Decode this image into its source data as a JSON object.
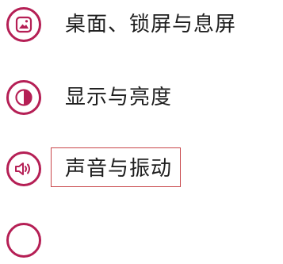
{
  "settings": {
    "items": [
      {
        "label": "桌面、锁屏与息屏",
        "icon": "wallpaper-icon"
      },
      {
        "label": "显示与亮度",
        "icon": "brightness-icon"
      },
      {
        "label": "声音与振动",
        "icon": "speaker-icon",
        "highlighted": true
      },
      {
        "label": "",
        "icon": "partial-icon"
      }
    ]
  },
  "colors": {
    "accent": "#b51f55",
    "highlight": "#c8464a",
    "text": "#1e1e1e",
    "background": "#ffffff"
  }
}
